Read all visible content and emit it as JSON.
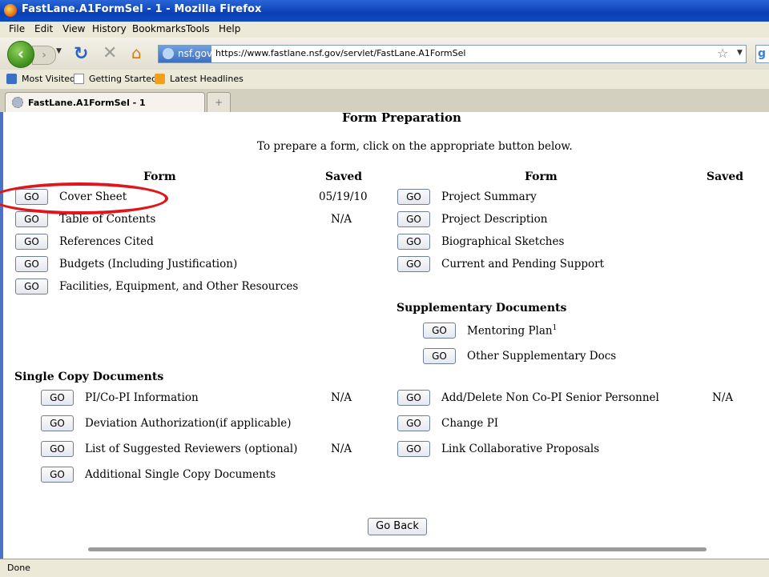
{
  "window": {
    "title": "FastLane.A1FormSel - 1 - Mozilla Firefox"
  },
  "menu": [
    "File",
    "Edit",
    "View",
    "History",
    "Bookmarks",
    "Tools",
    "Help"
  ],
  "nav": {
    "site_badge": "nsf.gov",
    "url": "https://www.fastlane.nsf.gov/servlet/FastLane.A1FormSel"
  },
  "bookmarks": [
    "Most Visited",
    "Getting Started",
    "Latest Headlines"
  ],
  "tab": {
    "label": "FastLane.A1FormSel - 1",
    "new_tab": "+"
  },
  "page": {
    "title": "Form Preparation",
    "instructions": "To prepare a form, click on the appropriate button below.",
    "col_headers": {
      "form": "Form",
      "saved": "Saved"
    },
    "go_label": "GO",
    "left_forms": [
      {
        "label": "Cover Sheet",
        "saved": "05/19/10"
      },
      {
        "label": "Table of Contents",
        "saved": "N/A"
      },
      {
        "label": "References Cited",
        "saved": ""
      },
      {
        "label": "Budgets (Including Justification)",
        "saved": ""
      },
      {
        "label": "Facilities, Equipment, and Other Resources",
        "saved": ""
      }
    ],
    "right_forms": [
      {
        "label": "Project Summary",
        "saved": ""
      },
      {
        "label": "Project Description",
        "saved": ""
      },
      {
        "label": "Biographical Sketches",
        "saved": ""
      },
      {
        "label": "Current and Pending Support",
        "saved": ""
      }
    ],
    "supplementary": {
      "heading": "Supplementary Documents",
      "items": [
        {
          "label": "Mentoring Plan",
          "superscript": "1"
        },
        {
          "label": "Other Supplementary Docs",
          "superscript": ""
        }
      ]
    },
    "single_copy": {
      "heading": "Single Copy Documents",
      "left": [
        {
          "label": "PI/Co-PI Information",
          "saved": "N/A"
        },
        {
          "label": "Deviation Authorization(if applicable)",
          "saved": ""
        },
        {
          "label": "List of Suggested Reviewers (optional)",
          "saved": "N/A"
        },
        {
          "label": "Additional Single Copy Documents",
          "saved": ""
        }
      ],
      "right": [
        {
          "label": "Add/Delete Non Co-PI Senior Personnel",
          "saved": "N/A"
        },
        {
          "label": "Change PI",
          "saved": ""
        },
        {
          "label": "Link Collaborative Proposals",
          "saved": ""
        }
      ]
    },
    "go_back": "Go Back"
  },
  "status": {
    "text": "Done"
  },
  "colors": {
    "annotation_circle": "#e0161b",
    "titlebar": "#0a3fb5"
  }
}
